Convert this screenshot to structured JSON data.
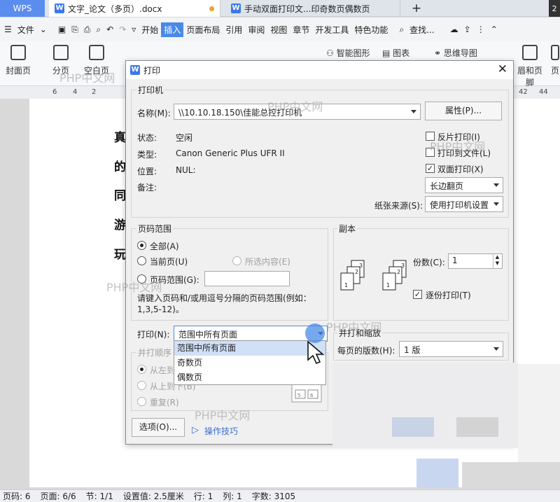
{
  "tabs": {
    "wps": "WPS",
    "doc1": "文字_论文（多页）.docx",
    "doc2": "手动双面打印文...印奇数页偶数页",
    "add": "+",
    "count": "2"
  },
  "menu": {
    "file": "文件",
    "items": [
      "开始",
      "插入",
      "页面布局",
      "引用",
      "审阅",
      "视图",
      "章节",
      "开发工具",
      "特色功能"
    ],
    "search": "查找..."
  },
  "ribbon": {
    "cover_page": "封面页",
    "page_break": "分页",
    "blank_page": "空白页",
    "smart_shape": "智能图形",
    "chart": "图表",
    "mind_map": "思维导图",
    "header_footer": "眉和页脚",
    "page": "页"
  },
  "ruler": {
    "ticks": [
      "6",
      "4",
      "2",
      "42",
      "44"
    ]
  },
  "document": {
    "chars": [
      "真",
      "的",
      "同",
      "游",
      "玩"
    ]
  },
  "dialog": {
    "title": "打印",
    "printer": {
      "group": "打印机",
      "name_label": "名称(M):",
      "name_value": "\\\\10.10.18.150\\佳能总控打印机",
      "properties": "属性(P)...",
      "status_label": "状态:",
      "status_value": "空闲",
      "type_label": "类型:",
      "type_value": "Canon Generic Plus UFR II",
      "location_label": "位置:",
      "location_value": "NUL:",
      "note_label": "备注:",
      "reverse": "反片打印(I)",
      "to_file": "打印到文件(L)",
      "duplex": "双面打印(X)",
      "duplex_mode": "长边翻页",
      "source_label": "纸张来源(S):",
      "source_value": "使用打印机设置"
    },
    "range": {
      "group": "页码范围",
      "all": "全部(A)",
      "current": "当前页(U)",
      "selection": "所选内容(E)",
      "pages": "页码范围(G):",
      "hint": "请键入页码和/或用逗号分隔的页码范围(例如：1,3,5-12)。"
    },
    "copies": {
      "group": "副本",
      "count_label": "份数(C):",
      "count_value": "1",
      "collate": "逐份打印(T)"
    },
    "print_label": "打印(N):",
    "print_value": "范围中所有页面",
    "print_options": [
      "范围中所有页面",
      "奇数页",
      "偶数页"
    ],
    "order": {
      "group": "并打顺序",
      "ltr": "从左到右",
      "ttb": "从上到下(B)",
      "repeat": "重复(R)"
    },
    "scale": {
      "group": "并打和缩放",
      "per_sheet_label": "每页的版数(H):",
      "per_sheet_value": "1 版"
    },
    "options_btn": "选项(O)...",
    "tips": "操作技巧"
  },
  "status": {
    "page_count": "页码: 6",
    "page": "页面: 6/6",
    "section": "节: 1/1",
    "setting": "设置值: 2.5厘米",
    "row": "行: 1",
    "col": "列: 1",
    "words": "字数: 3105"
  },
  "watermark": "PHP中文网",
  "colors": {
    "accent": "#4a8ae6",
    "wps_tab": "#5b8def",
    "highlight": "#cfe0f7"
  }
}
